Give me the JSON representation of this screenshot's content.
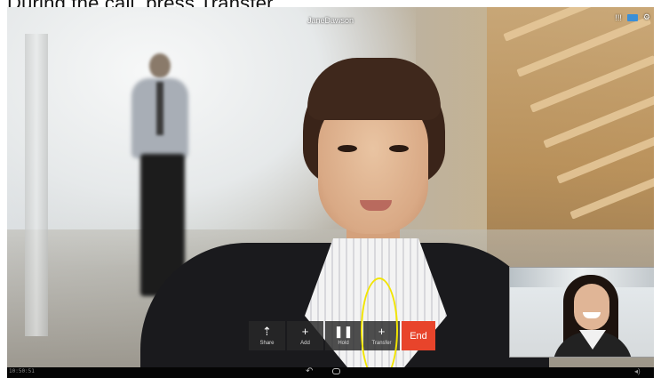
{
  "caption": "During the call, press Transfer",
  "call": {
    "caller_name": "JaneDawson"
  },
  "controls": [
    {
      "id": "share",
      "icon": "share-icon",
      "glyph": "⇡",
      "label": "Share"
    },
    {
      "id": "add",
      "icon": "add-person-icon",
      "glyph": "+",
      "label": "Add"
    },
    {
      "id": "hold",
      "icon": "pause-icon",
      "glyph": "❚❚",
      "label": "Hold"
    },
    {
      "id": "transfer",
      "icon": "transfer-person-icon",
      "glyph": "+",
      "label": "Transfer"
    }
  ],
  "end_label": "End",
  "status_bar": {
    "signal": "!!!",
    "settings": "⚙"
  },
  "navbar": {
    "clock": "10:50:51",
    "back": "↶",
    "volume": "◂)"
  },
  "colors": {
    "end_button": "#e8442b",
    "annotation": "#f2e500",
    "controls_bg": "#282828"
  }
}
